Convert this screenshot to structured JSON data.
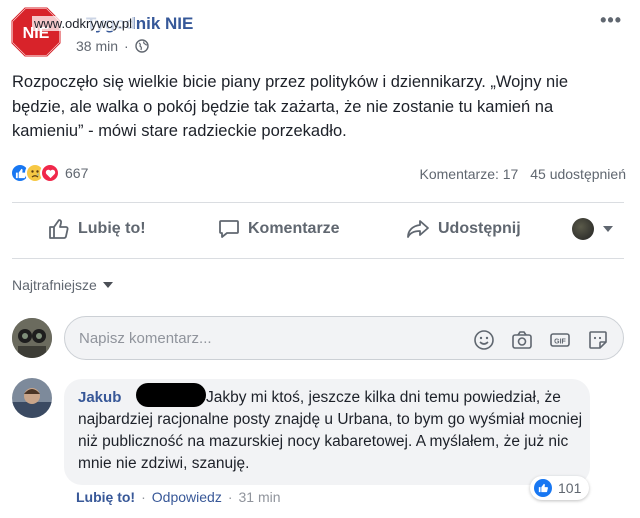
{
  "post": {
    "page_name": "Tygodnik NIE",
    "logo_text": "NIE",
    "watermark": "www.odkrywcy.pl",
    "time": "38 min",
    "separator": "·",
    "more": "•••",
    "text": "Rozpoczęło się wielkie bicie piany przez polityków i dziennikarzy. „Wojny nie będzie, ale walka o pokój będzie tak zażarta, że nie zostanie tu kamień na kamieniu” - mówi stare radzieckie porzekadło.",
    "reaction_count": "667",
    "comments_stat": "Komentarze: 17",
    "shares_stat": "45 udostępnień"
  },
  "actions": {
    "like": "Lubię to!",
    "comment": "Komentarze",
    "share": "Udostępnij"
  },
  "comments": {
    "sort_label": "Najtrafniejsze",
    "input_placeholder": "Napisz komentarz...",
    "items": [
      {
        "author": "Jakub",
        "text": "Jakby mi ktoś, jeszcze kilka dni temu powiedział, że najbardziej racjonalne posty znajdę u Urbana, to bym go wyśmiał mocniej niż publiczność na mazurskiej nocy kabaretowej. A myślałem, że już nic mnie nie zdziwi, szanuję.",
        "like_label": "Lubię to!",
        "reply_label": "Odpowiedz",
        "time": "31 min",
        "separator": "·",
        "likes": "101"
      }
    ]
  },
  "colors": {
    "link": "#365899",
    "like_blue": "#1877f2",
    "love_red": "#f0284a",
    "logo_red": "#d8232a"
  },
  "icons": [
    "globe-icon",
    "like-icon",
    "sad-icon",
    "love-icon",
    "thumbs-up-icon",
    "comment-icon",
    "share-icon",
    "chevron-down-icon",
    "smiley-icon",
    "camera-icon",
    "gif-icon",
    "sticker-icon"
  ]
}
